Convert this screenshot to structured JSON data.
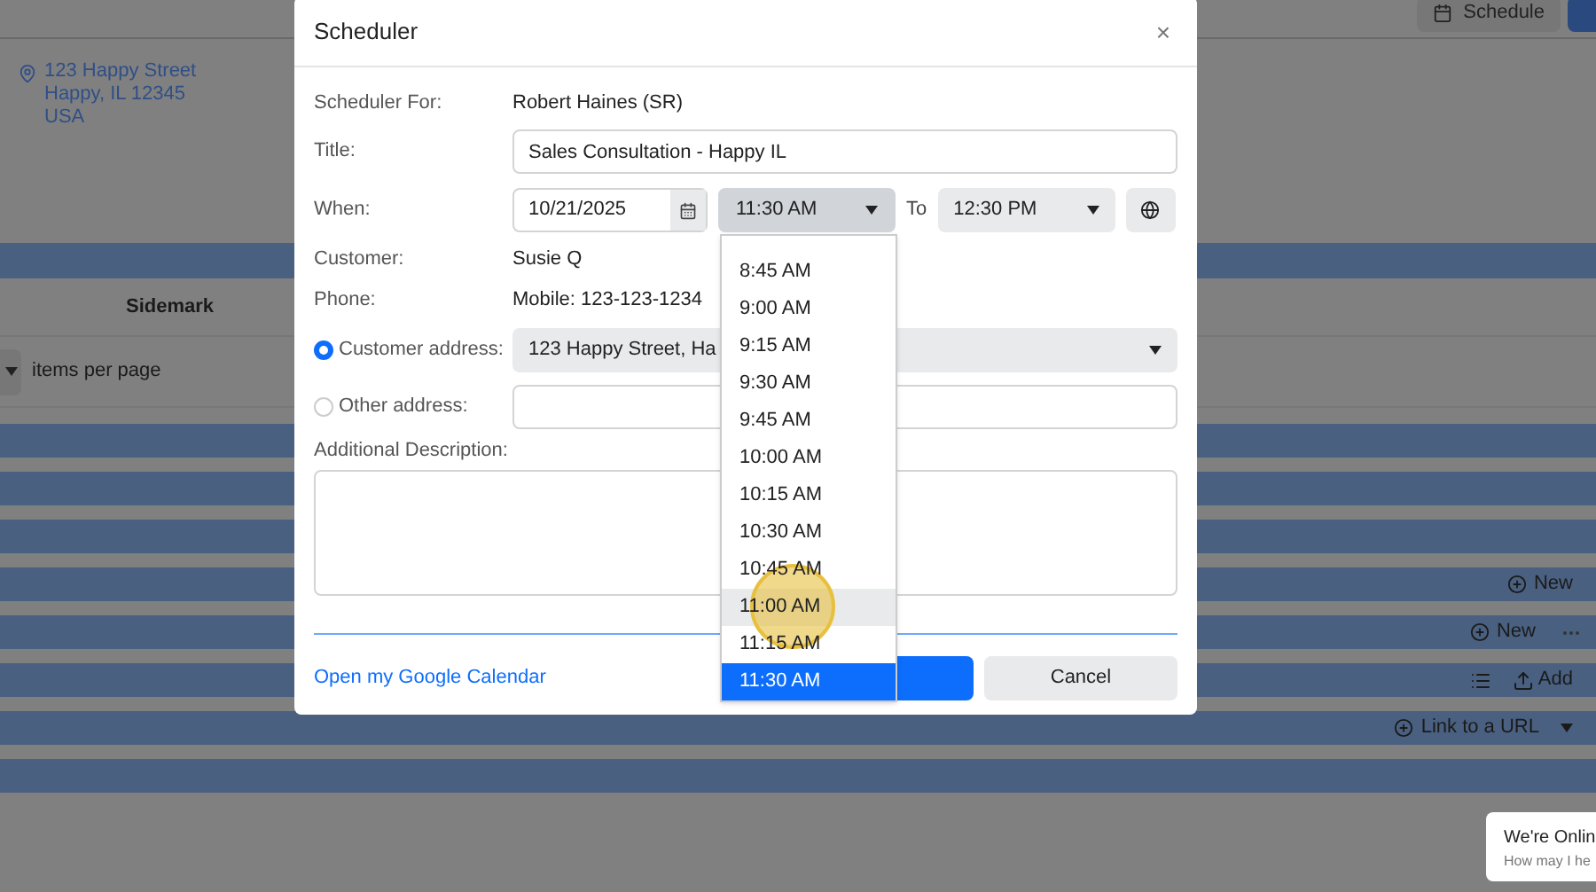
{
  "background": {
    "toolbar_button": "Schedule",
    "address_lines": [
      "123 Happy Street",
      "Happy, IL 12345",
      "USA"
    ],
    "table_header": "Sidemark",
    "pager_label": "items per page",
    "bands": [
      {
        "kind": "plain"
      },
      {
        "kind": "plain"
      },
      {
        "kind": "plain"
      },
      {
        "kind": "new",
        "label": "New"
      },
      {
        "kind": "new_more",
        "label": "New"
      },
      {
        "kind": "add",
        "label": "Add"
      },
      {
        "kind": "link",
        "label": "Link to a URL"
      },
      {
        "kind": "plain"
      }
    ]
  },
  "dialog": {
    "title": "Scheduler",
    "close": "×",
    "scheduler_for": {
      "label": "Scheduler For:",
      "value": "Robert Haines (SR)"
    },
    "title_field": {
      "label": "Title:",
      "value": "Sales Consultation - Happy IL"
    },
    "when": {
      "label": "When:",
      "date": "10/21/2025",
      "start": "11:30 AM",
      "to": "To",
      "end": "12:30 PM",
      "start_open": true
    },
    "customer": {
      "label": "Customer:",
      "value": "Susie Q"
    },
    "phone": {
      "label": "Phone:",
      "value": "Mobile: 123-123-1234"
    },
    "address_options": [
      {
        "label": "Customer address:",
        "selected": true,
        "value": "123 Happy Street, Ha"
      },
      {
        "label": "Other address:",
        "selected": false
      }
    ],
    "description_label": "Additional Description:",
    "calendar_link": "Open my Google Calendar",
    "cancel": "Cancel"
  },
  "time_dropdown": {
    "options": [
      {
        "label": "8:45 AM",
        "selected": false,
        "hovered": false
      },
      {
        "label": "9:00 AM",
        "selected": false,
        "hovered": false
      },
      {
        "label": "9:15 AM",
        "selected": false,
        "hovered": false
      },
      {
        "label": "9:30 AM",
        "selected": false,
        "hovered": false
      },
      {
        "label": "9:45 AM",
        "selected": false,
        "hovered": false
      },
      {
        "label": "10:00 AM",
        "selected": false,
        "hovered": false
      },
      {
        "label": "10:15 AM",
        "selected": false,
        "hovered": false
      },
      {
        "label": "10:30 AM",
        "selected": false,
        "hovered": false
      },
      {
        "label": "10:45 AM",
        "selected": false,
        "hovered": false
      },
      {
        "label": "11:00 AM",
        "selected": false,
        "hovered": true
      },
      {
        "label": "11:15 AM",
        "selected": false,
        "hovered": false
      },
      {
        "label": "11:30 AM",
        "selected": true,
        "hovered": false
      }
    ]
  },
  "chat": {
    "title": "We're Onlin",
    "subtitle": "How may I he"
  }
}
